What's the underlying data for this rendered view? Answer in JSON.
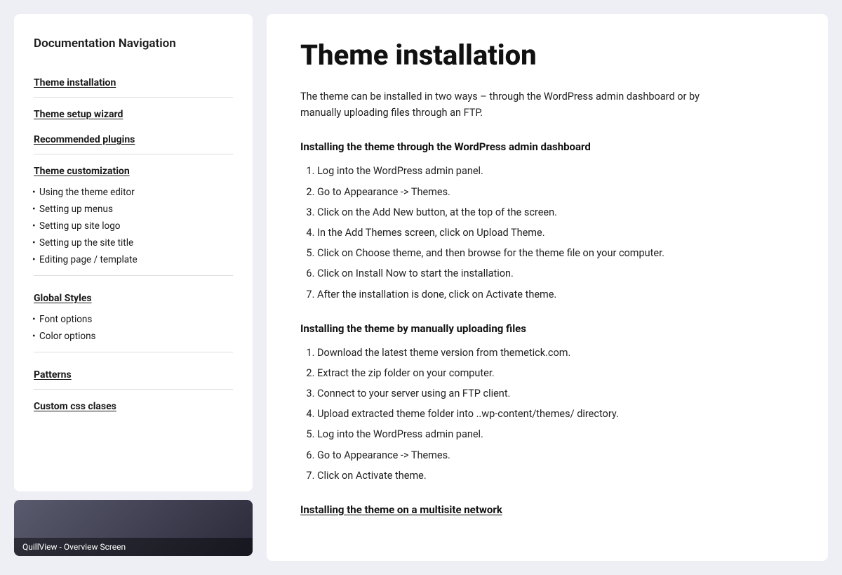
{
  "sidebar": {
    "title": "Documentation Navigation",
    "nav_items": [
      {
        "id": "theme-installation",
        "label": "Theme installation",
        "type": "link"
      },
      {
        "id": "divider-1",
        "type": "divider"
      },
      {
        "id": "theme-setup-wizard",
        "label": "Theme setup wizard",
        "type": "link"
      },
      {
        "id": "recommended-plugins",
        "label": "Recommended plugins",
        "type": "link"
      },
      {
        "id": "divider-2",
        "type": "divider"
      },
      {
        "id": "theme-customization",
        "label": "Theme customization",
        "type": "section-link"
      },
      {
        "id": "sub-using-theme-editor",
        "label": "Using the theme editor",
        "type": "sub-link"
      },
      {
        "id": "sub-setting-up-menus",
        "label": "Setting up menus",
        "type": "sub-link"
      },
      {
        "id": "sub-setting-up-site-logo",
        "label": "Setting up site logo",
        "type": "sub-link"
      },
      {
        "id": "sub-setting-up-site-title",
        "label": "Setting up the site title",
        "type": "sub-link"
      },
      {
        "id": "sub-editing-page-template",
        "label": "Editing page / template",
        "type": "sub-link"
      },
      {
        "id": "divider-3",
        "type": "divider"
      },
      {
        "id": "global-styles",
        "label": "Global Styles",
        "type": "section-link"
      },
      {
        "id": "sub-font-options",
        "label": "Font options",
        "type": "sub-link"
      },
      {
        "id": "sub-color-options",
        "label": "Color options",
        "type": "sub-link"
      },
      {
        "id": "divider-4",
        "type": "divider"
      },
      {
        "id": "patterns",
        "label": "Patterns",
        "type": "link"
      },
      {
        "id": "divider-5",
        "type": "divider"
      },
      {
        "id": "custom-css-classes",
        "label": "Custom css clases",
        "type": "link"
      }
    ]
  },
  "main": {
    "title": "Theme installation",
    "intro": "The theme can be installed in two ways – through the WordPress admin dashboard or by manually uploading files through an FTP.",
    "sections": [
      {
        "id": "admin-dashboard",
        "heading": "Installing the theme through the WordPress admin dashboard",
        "heading_style": "bold",
        "items": [
          "Log into the WordPress admin panel.",
          "Go to Appearance -> Themes.",
          "Click on the Add New button, at the top of the screen.",
          "In the Add Themes screen, click on Upload Theme.",
          "Click on Choose theme, and then browse for the theme file on your computer.",
          "Click on Install Now to start the installation.",
          "After the installation is done, click on Activate theme."
        ]
      },
      {
        "id": "manual-upload",
        "heading": "Installing the theme by manually uploading files",
        "heading_style": "bold",
        "items": [
          "Download the latest theme version from themetick.com.",
          "Extract the zip folder on your computer.",
          "Connect to your server using an FTP client.",
          "Upload extracted theme folder into ..wp-content/themes/ directory.",
          "Log into the WordPress admin panel.",
          "Go to Appearance -> Themes.",
          "Click on Activate theme."
        ]
      },
      {
        "id": "multisite",
        "heading": "Installing the theme on a multisite network",
        "heading_style": "underline"
      }
    ]
  },
  "thumbnail": {
    "label": "QuillView - Overview Screen"
  }
}
